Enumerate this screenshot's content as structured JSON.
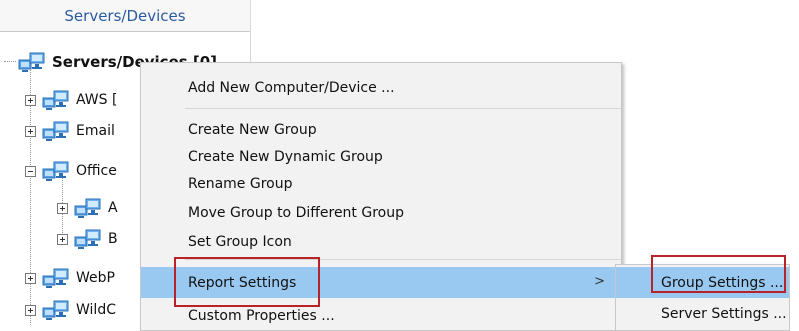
{
  "tree": {
    "header": "Servers/Devices",
    "root_label": "Servers/Devices [0]",
    "items": [
      {
        "label": "AWS [",
        "expander": "plus"
      },
      {
        "label": "Email",
        "expander": "plus"
      },
      {
        "label": "Office",
        "expander": "minus"
      },
      {
        "label": "A",
        "expander": "plus"
      },
      {
        "label": "B",
        "expander": "plus"
      },
      {
        "label": "WebP",
        "expander": "plus"
      },
      {
        "label": "WildC",
        "expander": "plus"
      }
    ]
  },
  "context_menu": {
    "items": [
      {
        "label": "Add New Computer/Device ..."
      },
      {
        "label": "Create New Group"
      },
      {
        "label": "Create New Dynamic Group"
      },
      {
        "label": "Rename Group"
      },
      {
        "label": "Move Group to Different Group"
      },
      {
        "label": "Set Group Icon"
      },
      {
        "label": "Report Settings",
        "submenu_arrow": ">"
      },
      {
        "label": "Custom Properties ..."
      }
    ]
  },
  "submenu": {
    "items": [
      {
        "label": "Group Settings ..."
      },
      {
        "label": "Server Settings ..."
      }
    ]
  },
  "colors": {
    "highlight": "#99c9f1",
    "annotation_red": "#b8232a",
    "header_text": "#2c5aa0"
  }
}
